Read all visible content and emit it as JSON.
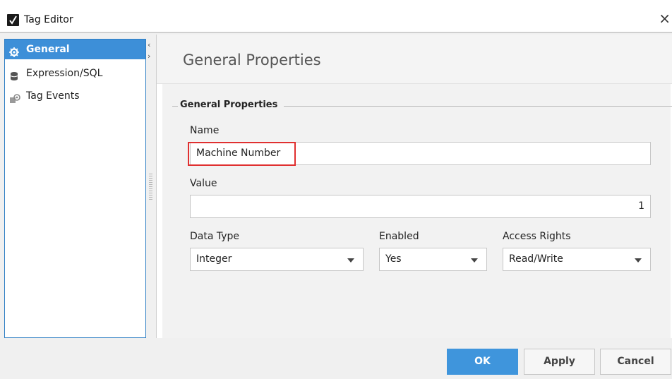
{
  "window": {
    "title": "Tag Editor",
    "close_glyph": "×",
    "icon": "checkmark-app-icon"
  },
  "sidebar": {
    "items": [
      {
        "label": "General",
        "icon": "gear-icon",
        "selected": true
      },
      {
        "label": "Expression/SQL",
        "icon": "database-icon",
        "selected": false
      },
      {
        "label": "Tag Events",
        "icon": "tag-events-icon",
        "selected": false
      }
    ],
    "collapse_left": "‹",
    "collapse_right": "›"
  },
  "main": {
    "page_title": "General Properties",
    "section_title": "General Properties",
    "fields": {
      "name_label": "Name",
      "name_value": "Machine Number",
      "value_label": "Value",
      "value_value": "1",
      "data_type_label": "Data Type",
      "data_type_value": "Integer",
      "enabled_label": "Enabled",
      "enabled_value": "Yes",
      "access_label": "Access Rights",
      "access_value": "Read/Write"
    }
  },
  "footer": {
    "ok": "OK",
    "apply": "Apply",
    "cancel": "Cancel"
  },
  "colors": {
    "accent": "#3d8fd8",
    "highlight": "#e03030"
  }
}
